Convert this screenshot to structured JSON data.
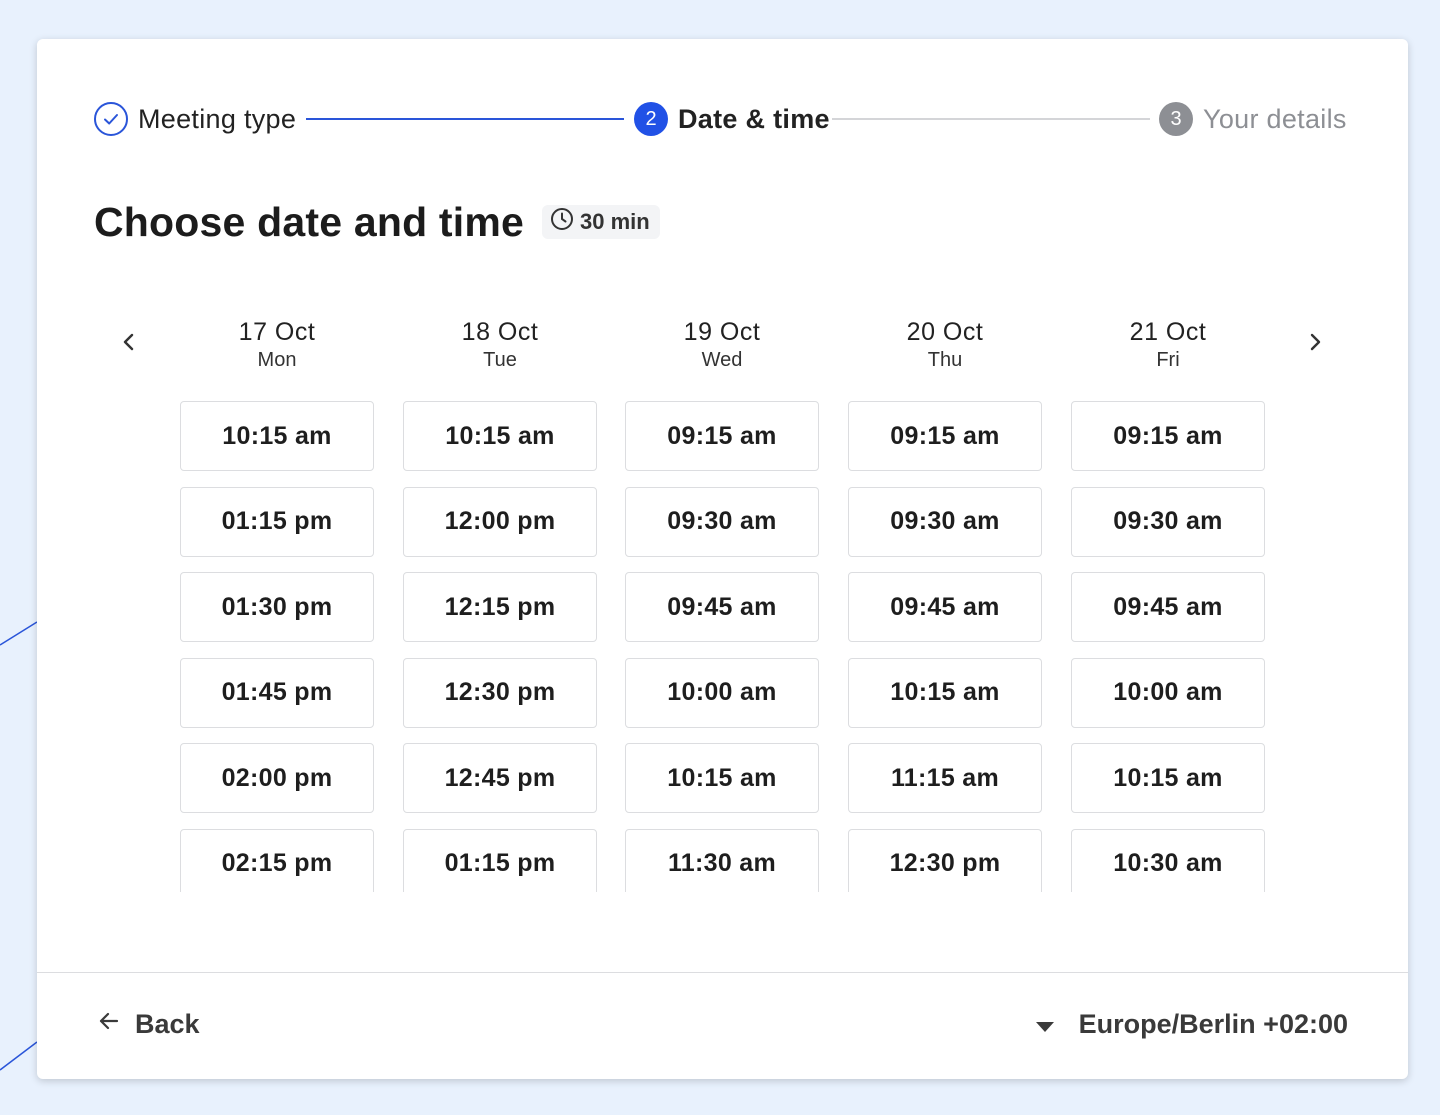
{
  "stepper": {
    "steps": [
      {
        "number": "",
        "label": "Meeting type",
        "state": "completed"
      },
      {
        "number": "2",
        "label": "Date & time",
        "state": "active"
      },
      {
        "number": "3",
        "label": "Your details",
        "state": "upcoming"
      }
    ]
  },
  "header": {
    "title": "Choose date and time",
    "duration": "30 min",
    "duration_icon": "clock-icon"
  },
  "calendar": {
    "prev_icon": "chevron-left-icon",
    "next_icon": "chevron-right-icon",
    "days": [
      {
        "date": "17 Oct",
        "weekday": "Mon",
        "slots": [
          "10:15 am",
          "01:15 pm",
          "01:30 pm",
          "01:45 pm",
          "02:00 pm",
          "02:15 pm"
        ]
      },
      {
        "date": "18 Oct",
        "weekday": "Tue",
        "slots": [
          "10:15 am",
          "12:00 pm",
          "12:15 pm",
          "12:30 pm",
          "12:45 pm",
          "01:15 pm"
        ]
      },
      {
        "date": "19 Oct",
        "weekday": "Wed",
        "slots": [
          "09:15 am",
          "09:30 am",
          "09:45 am",
          "10:00 am",
          "10:15 am",
          "11:30 am"
        ]
      },
      {
        "date": "20 Oct",
        "weekday": "Thu",
        "slots": [
          "09:15 am",
          "09:30 am",
          "09:45 am",
          "10:15 am",
          "11:15 am",
          "12:30 pm"
        ]
      },
      {
        "date": "21 Oct",
        "weekday": "Fri",
        "slots": [
          "09:15 am",
          "09:30 am",
          "09:45 am",
          "10:00 am",
          "10:15 am",
          "10:30 am"
        ]
      }
    ]
  },
  "footer": {
    "back_label": "Back",
    "timezone": "Europe/Berlin +02:00"
  },
  "colors": {
    "accent": "#2151e6",
    "muted": "#8d8f94",
    "background": "#e8f1fd"
  }
}
